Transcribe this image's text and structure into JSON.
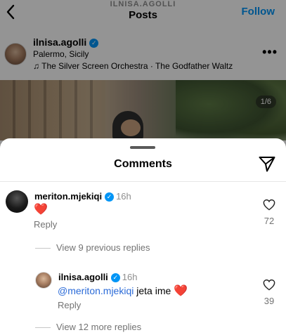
{
  "header": {
    "subtitle": "ILNISA.AGOLLI",
    "title": "Posts",
    "follow_label": "Follow"
  },
  "post": {
    "username": "ilnisa.agolli",
    "location": "Palermo, Sicily",
    "music": "The Silver Screen Orchestra · The Godfather Waltz",
    "more_label": "•••",
    "page_indicator": "1/6"
  },
  "comments_sheet": {
    "title": "Comments",
    "comment": {
      "username": "meriton.mjekiqi",
      "time": "16h",
      "text": "❤️",
      "reply_label": "Reply",
      "likes": "72"
    },
    "view_previous": "View 9 previous replies",
    "reply": {
      "username": "ilnisa.agolli",
      "time": "16h",
      "mention": "@meriton.mjekiqi",
      "text": " jeta ime ",
      "emoji": "❤️",
      "reply_label": "Reply",
      "likes": "39"
    },
    "view_more": "View 12 more replies"
  },
  "colors": {
    "accent": "#0095f6",
    "mention": "#2b6bd8",
    "heart": "#e0245e",
    "secondary_text": "#737373"
  },
  "icons": [
    "back-icon",
    "verified-icon",
    "music-note-icon",
    "more-icon",
    "send-icon",
    "heart-icon"
  ]
}
